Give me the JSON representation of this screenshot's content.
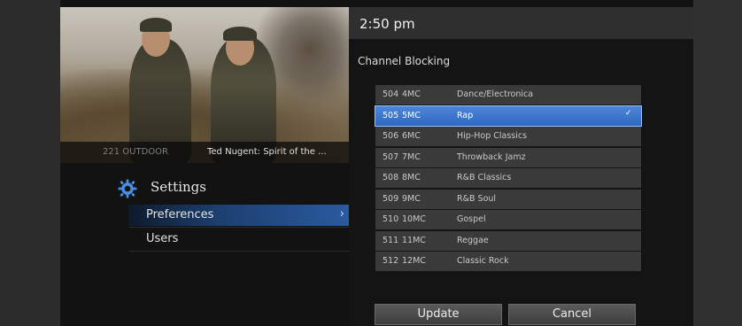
{
  "video": {
    "channel": "221 OUTDOOR",
    "program": "Ted Nugent: Spirit of the ..."
  },
  "header": {
    "time": "2:50 pm",
    "title": "Channel Blocking"
  },
  "settings": {
    "title": "Settings",
    "menu": [
      {
        "label": "Preferences",
        "selected": true
      },
      {
        "label": "Users",
        "selected": false
      }
    ]
  },
  "channels": [
    {
      "num": "504",
      "call": "4MC",
      "name": "Dance/Electronica",
      "selected": false
    },
    {
      "num": "505",
      "call": "5MC",
      "name": "Rap",
      "selected": true
    },
    {
      "num": "506",
      "call": "6MC",
      "name": "Hip-Hop Classics",
      "selected": false
    },
    {
      "num": "507",
      "call": "7MC",
      "name": "Throwback Jamz",
      "selected": false
    },
    {
      "num": "508",
      "call": "8MC",
      "name": "R&B Classics",
      "selected": false
    },
    {
      "num": "509",
      "call": "9MC",
      "name": "R&B Soul",
      "selected": false
    },
    {
      "num": "510",
      "call": "10MC",
      "name": "Gospel",
      "selected": false
    },
    {
      "num": "511",
      "call": "11MC",
      "name": "Reggae",
      "selected": false
    },
    {
      "num": "512",
      "call": "12MC",
      "name": "Classic Rock",
      "selected": false
    }
  ],
  "buttons": {
    "update": "Update",
    "cancel": "Cancel"
  },
  "icons": {
    "settings": "gear-icon",
    "chevron": "chevron-right-icon",
    "selected_channel": "check-icon"
  },
  "colors": {
    "accent": "#2f68c0",
    "panel": "#3a3a3a"
  }
}
